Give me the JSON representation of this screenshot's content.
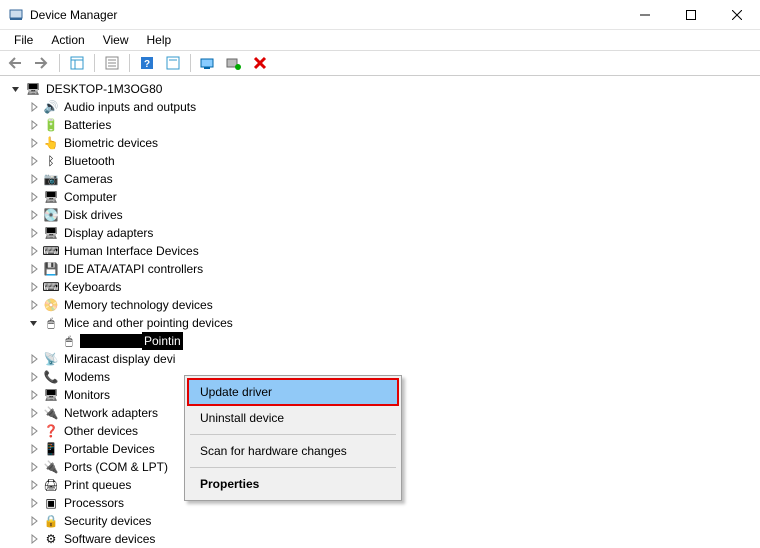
{
  "title": "Device Manager",
  "menus": {
    "file": "File",
    "action": "Action",
    "view": "View",
    "help": "Help"
  },
  "root_label": "DESKTOP-1M3OG80",
  "categories": [
    {
      "label": "Audio inputs and outputs",
      "icon": "audio",
      "expanded": false
    },
    {
      "label": "Batteries",
      "icon": "battery",
      "expanded": false
    },
    {
      "label": "Biometric devices",
      "icon": "biometric",
      "expanded": false
    },
    {
      "label": "Bluetooth",
      "icon": "bluetooth",
      "expanded": false
    },
    {
      "label": "Cameras",
      "icon": "camera",
      "expanded": false
    },
    {
      "label": "Computer",
      "icon": "computer",
      "expanded": false
    },
    {
      "label": "Disk drives",
      "icon": "disk",
      "expanded": false
    },
    {
      "label": "Display adapters",
      "icon": "display",
      "expanded": false
    },
    {
      "label": "Human Interface Devices",
      "icon": "hid",
      "expanded": false
    },
    {
      "label": "IDE ATA/ATAPI controllers",
      "icon": "ide",
      "expanded": false
    },
    {
      "label": "Keyboards",
      "icon": "keyboard",
      "expanded": false
    },
    {
      "label": "Memory technology devices",
      "icon": "memory",
      "expanded": false
    },
    {
      "label": "Mice and other pointing devices",
      "icon": "mouse",
      "expanded": true,
      "children": [
        {
          "redacted": true,
          "suffix": "Pointin",
          "icon": "mouse",
          "selected": true
        }
      ]
    },
    {
      "label": "Miracast display devi",
      "icon": "miracast",
      "expanded": false
    },
    {
      "label": "Modems",
      "icon": "modem",
      "expanded": false
    },
    {
      "label": "Monitors",
      "icon": "monitor",
      "expanded": false
    },
    {
      "label": "Network adapters",
      "icon": "network",
      "expanded": false
    },
    {
      "label": "Other devices",
      "icon": "other",
      "expanded": false
    },
    {
      "label": "Portable Devices",
      "icon": "portable",
      "expanded": false
    },
    {
      "label": "Ports (COM & LPT)",
      "icon": "ports",
      "expanded": false
    },
    {
      "label": "Print queues",
      "icon": "print",
      "expanded": false
    },
    {
      "label": "Processors",
      "icon": "cpu",
      "expanded": false
    },
    {
      "label": "Security devices",
      "icon": "security",
      "expanded": false
    },
    {
      "label": "Software devices",
      "icon": "software",
      "expanded": false
    }
  ],
  "context_menu": {
    "update": "Update driver",
    "uninstall": "Uninstall device",
    "scan": "Scan for hardware changes",
    "properties": "Properties"
  },
  "icons": {
    "audio": "🔊",
    "battery": "🔋",
    "biometric": "👆",
    "bluetooth": "ᛒ",
    "camera": "📷",
    "computer": "🖥",
    "disk": "💽",
    "display": "🖥",
    "hid": "⌨",
    "ide": "💾",
    "keyboard": "⌨",
    "memory": "📀",
    "mouse": "🖱",
    "miracast": "📡",
    "modem": "📞",
    "monitor": "🖥",
    "network": "🔌",
    "other": "❓",
    "portable": "📱",
    "ports": "🔌",
    "print": "🖨",
    "cpu": "▣",
    "security": "🔒",
    "software": "⚙",
    "pc": "🖥"
  }
}
